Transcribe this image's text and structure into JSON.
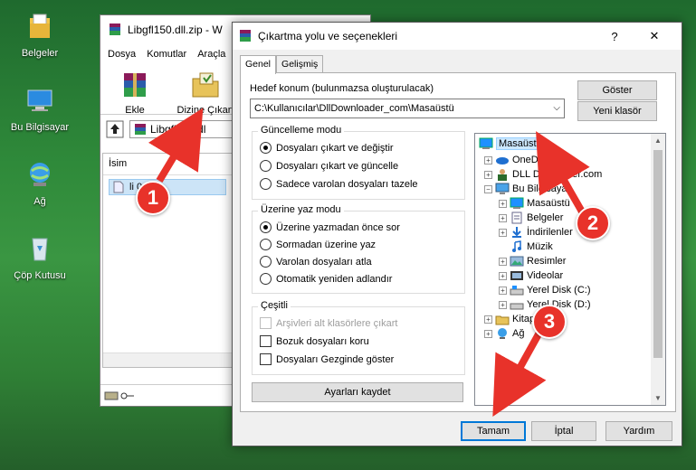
{
  "desktop": {
    "icons": [
      {
        "label": "Belgeler"
      },
      {
        "label": "Bu Bilgisayar"
      },
      {
        "label": "Ağ"
      },
      {
        "label": "Çöp Kutusu"
      }
    ]
  },
  "winrar": {
    "title": "Libgfl150.dll.zip - W",
    "menu": [
      "Dosya",
      "Komutlar",
      "Araçla"
    ],
    "tools": [
      {
        "label": "Ekle"
      },
      {
        "label": "Dizine Çıkart"
      }
    ],
    "path": "Libgfl150.dl",
    "column_name": "İsim",
    "file": "li          0.dll"
  },
  "dialog": {
    "title": "Çıkartma yolu ve seçenekleri",
    "help": "?",
    "close": "✕",
    "tabs": [
      "Genel",
      "Gelişmiş"
    ],
    "dest_label": "Hedef konum (bulunmazsa oluşturulacak)",
    "dest_value": "C:\\Kullanıcılar\\DllDownloader_com\\Masaüstü",
    "btn_show": "Göster",
    "btn_new_folder": "Yeni klasör",
    "update_group": {
      "title": "Güncelleme modu",
      "options": [
        "Dosyaları çıkart ve değiştir",
        "Dosyaları çıkart ve güncelle",
        "Sadece varolan dosyaları tazele"
      ],
      "selected": 0
    },
    "overwrite_group": {
      "title": "Üzerine yaz modu",
      "options": [
        "Üzerine yazmadan önce sor",
        "Sormadan üzerine yaz",
        "Varolan dosyaları atla",
        "Otomatik yeniden adlandır"
      ],
      "selected": 0
    },
    "misc_group": {
      "title": "Çeşitli",
      "options": [
        "Arşivleri alt klasörlere çıkart",
        "Bozuk dosyaları koru",
        "Dosyaları Gezginde göster"
      ]
    },
    "btn_save": "Ayarları kaydet",
    "tree": [
      {
        "label": "Masaüstü",
        "icon": "desktop-icon",
        "selected": true
      },
      {
        "label": "OneDri",
        "icon": "cloud-icon"
      },
      {
        "label": "DLL Dow          nader.com",
        "icon": "user-icon"
      },
      {
        "label": "Bu Bilgisaya",
        "icon": "computer-icon"
      },
      {
        "label": "Masaüstü",
        "icon": "desktop-icon"
      },
      {
        "label": "Belgeler",
        "icon": "documents-icon"
      },
      {
        "label": "İndirilenler",
        "icon": "download-icon"
      },
      {
        "label": "Müzik",
        "icon": "music-icon"
      },
      {
        "label": "Resimler",
        "icon": "pictures-icon"
      },
      {
        "label": "Videolar",
        "icon": "video-icon"
      },
      {
        "label": "Yerel Disk (C:)",
        "icon": "drive-icon"
      },
      {
        "label": "Yerel Disk (D:)",
        "icon": "drive-icon"
      },
      {
        "label": "Kitap",
        "icon": "library-icon"
      },
      {
        "label": "Ağ",
        "icon": "network-icon"
      }
    ],
    "btn_ok": "Tamam",
    "btn_cancel": "İptal",
    "btn_help": "Yardım"
  },
  "callouts": [
    "1",
    "2",
    "3"
  ],
  "colors": {
    "callout": "#e8322a",
    "selection": "#cce8ff",
    "accent": "#0078d7"
  }
}
